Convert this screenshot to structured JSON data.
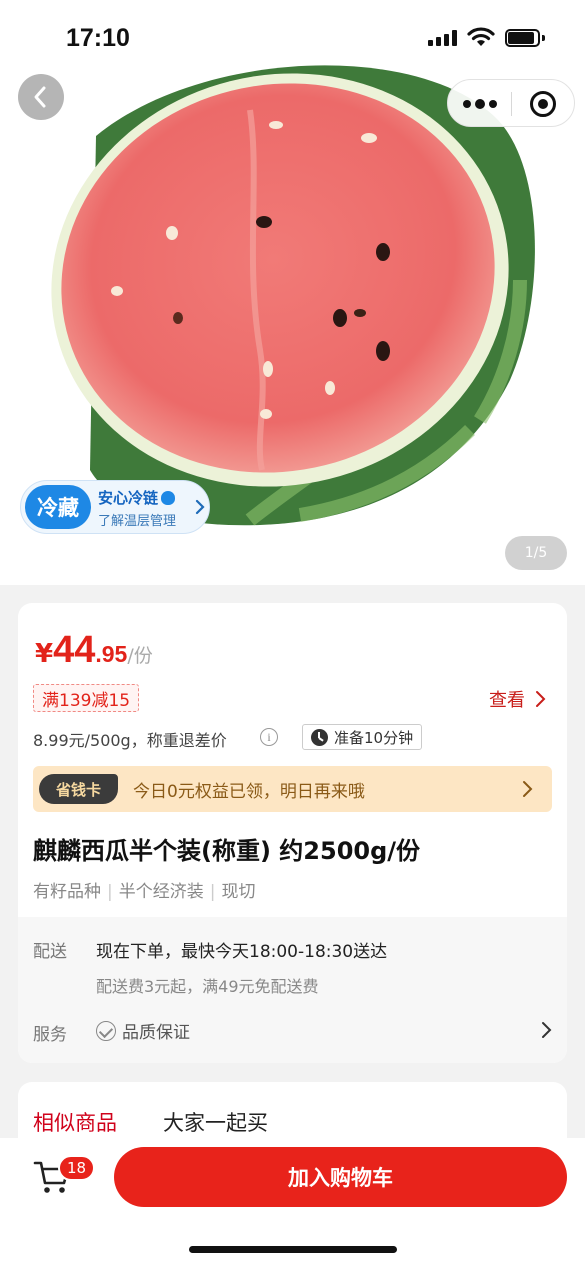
{
  "status_bar": {
    "time": "17:10"
  },
  "gallery": {
    "image_desc": "half watermelon",
    "page_indicator": "1/5",
    "cold_badge": {
      "chip": "冷藏",
      "title": "安心冷链",
      "subtitle": "了解温层管理"
    }
  },
  "price": {
    "currency": "¥",
    "integer": "44",
    "decimal": ".95",
    "unit": "/份"
  },
  "promo": {
    "tag": "满139减15",
    "view_label": "查看"
  },
  "unit_price": "8.99元/500g，称重退差价",
  "prep_time": "准备10分钟",
  "saver_card": {
    "chip": "省钱卡",
    "text": "今日0元权益已领，明日再来哦"
  },
  "product": {
    "title": "麒麟西瓜半个装(称重) 约2500g/份",
    "tags": [
      "有籽品种",
      "半个经济装",
      "现切"
    ]
  },
  "delivery": {
    "label": "配送",
    "main": "现在下单，最快今天18:00-18:30送达",
    "sub": "配送费3元起，满49元免配送费"
  },
  "service": {
    "label": "服务",
    "item": "品质保证"
  },
  "tabs": [
    {
      "label": "相似商品",
      "active": true
    },
    {
      "label": "大家一起买",
      "active": false
    }
  ],
  "bottom_bar": {
    "cart_count": "18",
    "add_to_cart": "加入购物车"
  },
  "colors": {
    "accent_red": "#e8231b",
    "price_red": "#e2231a",
    "cold_blue": "#1e88e5",
    "saver_bg": "#fde6c4"
  },
  "icons": [
    "back-arrow-icon",
    "more-dots-icon",
    "target-icon",
    "shield-icon",
    "chevron-right-icon",
    "info-icon",
    "clock-icon",
    "check-circle-icon",
    "cart-icon"
  ]
}
